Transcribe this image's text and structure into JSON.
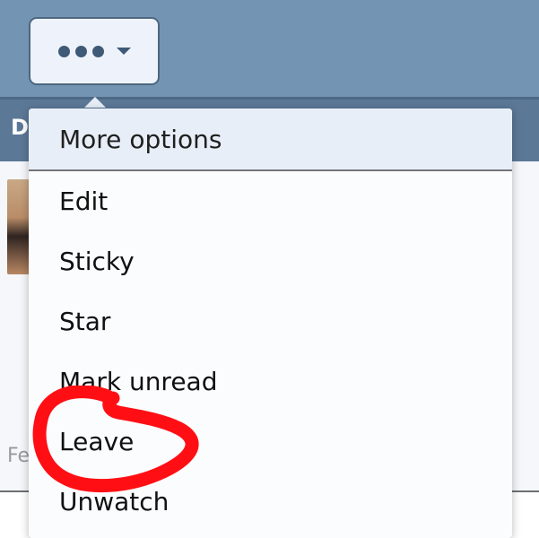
{
  "toolbar": {
    "more_icon": "more-horizontal-icon",
    "caret_icon": "chevron-down-icon"
  },
  "header": {
    "partial_letter": "D"
  },
  "content": {
    "footer_partial": "Fe"
  },
  "menu": {
    "title": "More options",
    "items": [
      {
        "label": "Edit"
      },
      {
        "label": "Sticky"
      },
      {
        "label": "Star"
      },
      {
        "label": "Mark unread"
      },
      {
        "label": "Leave"
      },
      {
        "label": "Unwatch"
      }
    ]
  },
  "annotation": {
    "highlight_color": "#ff0f14"
  }
}
